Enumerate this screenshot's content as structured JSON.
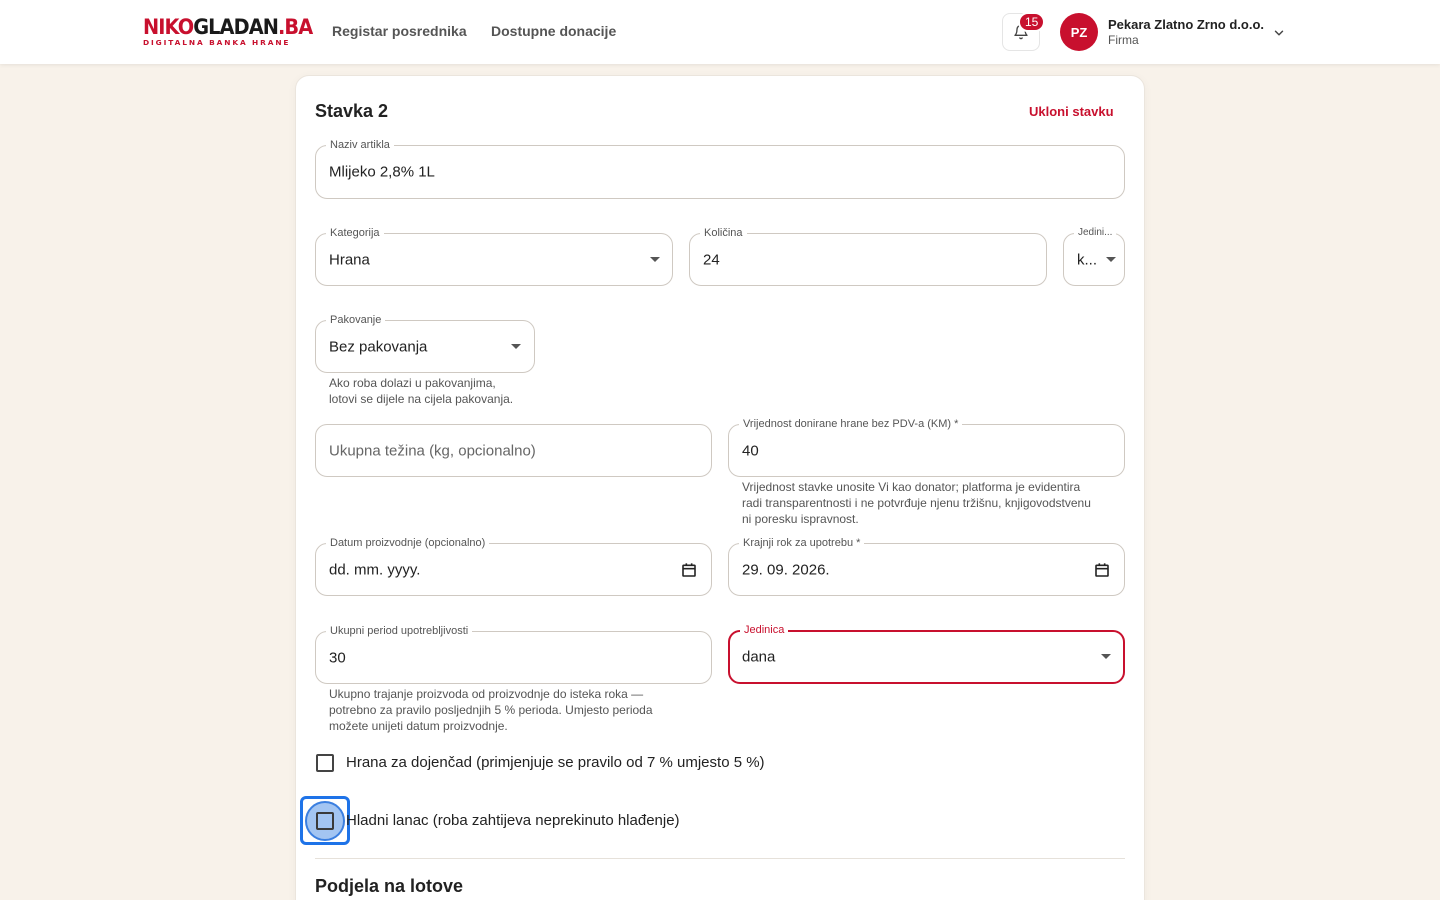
{
  "header": {
    "logo": {
      "part1": "NIKO",
      "part2": "GLADAN",
      "part3": ".BA",
      "tagline": "DIGITALNA BANKA HRANE"
    },
    "nav": [
      "Registar posrednika",
      "Dostupne donacije"
    ],
    "notifications_count": "15",
    "user": {
      "initials": "PZ",
      "name": "Pekara Zlatno Zrno d.o.o.",
      "role": "Firma"
    }
  },
  "item": {
    "title": "Stavka 2",
    "remove_label": "Ukloni stavku",
    "name": {
      "label": "Naziv artikla",
      "value": "Mlijeko 2,8% 1L"
    },
    "category": {
      "label": "Kategorija",
      "value": "Hrana"
    },
    "quantity": {
      "label": "Količina",
      "value": "24"
    },
    "unit": {
      "label": "Jedini...",
      "value": "k..."
    },
    "packaging": {
      "label": "Pakovanje",
      "value": "Bez pakovanja",
      "helper_line1": "Ako roba dolazi u pakovanjima,",
      "helper_line2": "lotovi se dijele na cijela pakovanja."
    },
    "weight": {
      "placeholder": "Ukupna težina (kg, opcionalno)"
    },
    "value": {
      "label": "Vrijednost donirane hrane bez PDV-a (KM) *",
      "value": "40",
      "helper_line1": "Vrijednost stavke unosite Vi kao donator; platforma je evidentira",
      "helper_line2": "radi transparentnosti i ne potvrđuje njenu tržišnu, knjigovodstvenu",
      "helper_line3": "ni poresku ispravnost."
    },
    "production_date": {
      "label": "Datum proizvodnje (opcionalno)",
      "value": "dd. mm. yyyy."
    },
    "expiry_date": {
      "label": "Krajnji rok za upotrebu *",
      "value": "29. 09. 2026."
    },
    "shelf_life": {
      "label": "Ukupni period upotrebljivosti",
      "value": "30",
      "helper_line1": "Ukupno trajanje proizvoda od proizvodnje do isteka roka —",
      "helper_line2": "potrebno za pravilo posljednjih 5 % perioda. Umjesto perioda",
      "helper_line3": "možete unijeti datum proizvodnje."
    },
    "shelf_unit": {
      "label": "Jedinica",
      "value": "dana"
    },
    "infant_food": {
      "label": "Hrana za dojenčad (primjenjuje se pravilo od 7 % umjesto 5 %)",
      "checked": false
    },
    "cold_chain": {
      "label": "Hladni lanac (roba zahtijeva neprekinuto hlađenje)",
      "checked": false
    },
    "lots_title": "Podjela na lotove"
  },
  "colors": {
    "accent": "#c8102e",
    "focus": "#1e73e8",
    "background": "#f8f2ea"
  },
  "icons": [
    "bell-icon",
    "chevron-down-icon",
    "caret-down-icon",
    "calendar-icon"
  ]
}
